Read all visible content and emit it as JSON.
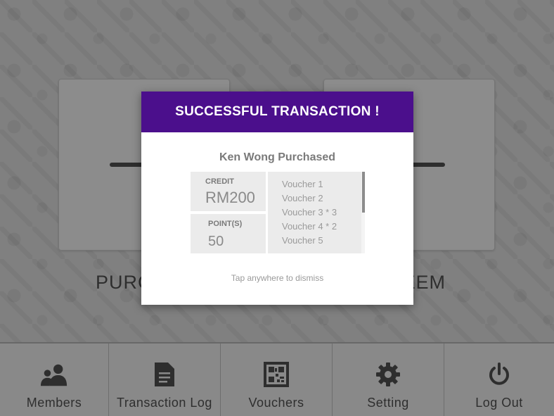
{
  "main": {
    "purchase_label": "PURCHASE",
    "redeem_label": "REDEEM"
  },
  "nav": {
    "items": [
      {
        "label": "Members",
        "icon": "members-icon"
      },
      {
        "label": "Transaction Log",
        "icon": "document-icon"
      },
      {
        "label": "Vouchers",
        "icon": "qr-code-icon"
      },
      {
        "label": "Setting",
        "icon": "gear-icon"
      },
      {
        "label": "Log Out",
        "icon": "power-icon"
      }
    ]
  },
  "modal": {
    "title": "SUCCESSFUL TRANSACTION !",
    "subtitle": "Ken Wong Purchased",
    "credit_title": "CREDIT",
    "credit_value": "RM200",
    "points_title": "POINT(S)",
    "points_value": "50",
    "vouchers": [
      "Voucher 1",
      "Voucher 2",
      "Voucher 3 * 3",
      "Voucher 4 * 2",
      "Voucher 5"
    ],
    "dismiss_hint": "Tap anywhere to dismiss"
  },
  "colors": {
    "modal_header": "#4b0f8c",
    "overlay": "rgba(0,0,0,0.45)"
  }
}
